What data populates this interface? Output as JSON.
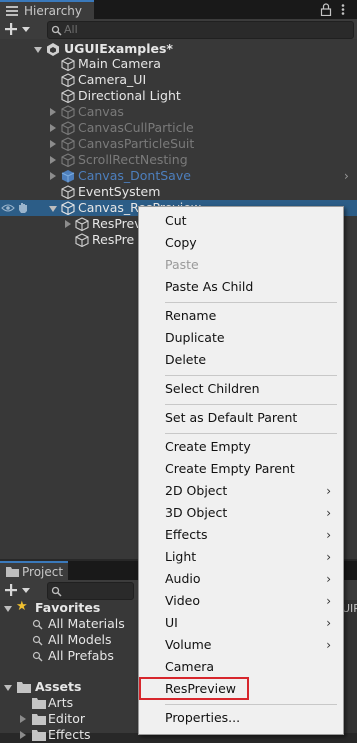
{
  "hierarchy": {
    "tab_label": "Hierarchy",
    "search_placeholder": "All",
    "scene_name": "UGUIExamples*",
    "items": [
      {
        "label": "Main Camera"
      },
      {
        "label": "Camera_UI"
      },
      {
        "label": "Directional Light"
      },
      {
        "label": "Canvas"
      },
      {
        "label": "CanvasCullParticle"
      },
      {
        "label": "CanvasParticleSuit"
      },
      {
        "label": "ScrollRectNesting"
      },
      {
        "label": "Canvas_DontSave"
      },
      {
        "label": "EventSystem"
      },
      {
        "label": "Canvas_ResPreview"
      },
      {
        "label": "ResPrev"
      },
      {
        "label": "ResPre"
      }
    ]
  },
  "project": {
    "tab_label": "Project",
    "favorites_label": "Favorites",
    "favorites": [
      {
        "label": "All Materials"
      },
      {
        "label": "All Models"
      },
      {
        "label": "All Prefabs"
      }
    ],
    "assets_label": "Assets",
    "assets": [
      {
        "label": "Arts"
      },
      {
        "label": "Editor"
      },
      {
        "label": "Effects"
      }
    ],
    "side_label": "UIP"
  },
  "context_menu": {
    "items": [
      {
        "label": "Cut"
      },
      {
        "label": "Copy"
      },
      {
        "label": "Paste"
      },
      {
        "label": "Paste As Child"
      },
      {
        "label": "Rename"
      },
      {
        "label": "Duplicate"
      },
      {
        "label": "Delete"
      },
      {
        "label": "Select Children"
      },
      {
        "label": "Set as Default Parent"
      },
      {
        "label": "Create Empty"
      },
      {
        "label": "Create Empty Parent"
      },
      {
        "label": "2D Object"
      },
      {
        "label": "3D Object"
      },
      {
        "label": "Effects"
      },
      {
        "label": "Light"
      },
      {
        "label": "Audio"
      },
      {
        "label": "Video"
      },
      {
        "label": "UI"
      },
      {
        "label": "Volume"
      },
      {
        "label": "Camera"
      },
      {
        "label": "ResPreview"
      },
      {
        "label": "Properties..."
      }
    ],
    "submenu_arrow": "›",
    "highlight_color": "#d7262c"
  },
  "colors": {
    "selection": "#2c5d87",
    "tab_accent": "#3a79bb",
    "prefab_blue": "#4d7fbd"
  }
}
